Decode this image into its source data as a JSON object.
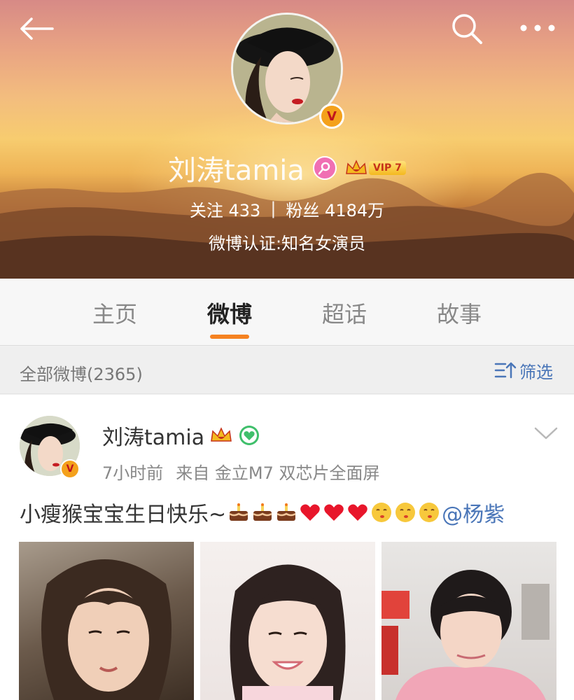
{
  "header": {
    "name": "刘涛tamia",
    "vip_label": "VIP 7",
    "following_label": "关注",
    "following_count": "433",
    "separator": "|",
    "followers_label": "粉丝",
    "followers_count": "4184万",
    "verification": "微博认证:知名女演员",
    "icons": [
      "back-arrow-icon",
      "search-icon",
      "more-icon",
      "verified-v-icon",
      "female-gender-icon",
      "vip-crown-icon"
    ]
  },
  "tabs": [
    {
      "label": "主页",
      "active": false
    },
    {
      "label": "微博",
      "active": true
    },
    {
      "label": "超话",
      "active": false
    },
    {
      "label": "故事",
      "active": false
    }
  ],
  "filter": {
    "count_label": "全部微博(2365)",
    "filter_label": "筛选"
  },
  "post": {
    "author": "刘涛tamia",
    "time": "7小时前",
    "source_prefix": "来自",
    "source_device": "金立M7",
    "source_desc": "双芯片全面屏",
    "text": "小瘦猴宝宝生日快乐~",
    "emojis": [
      "cake",
      "cake",
      "cake",
      "heart",
      "heart",
      "heart",
      "kiss",
      "kiss",
      "kiss"
    ],
    "mention": "@杨紫",
    "photos": [
      "photo-1",
      "photo-2",
      "photo-3"
    ]
  },
  "colors": {
    "accent": "#f58220",
    "link": "#4a76b8",
    "vip_gold": "#f4b91f"
  }
}
